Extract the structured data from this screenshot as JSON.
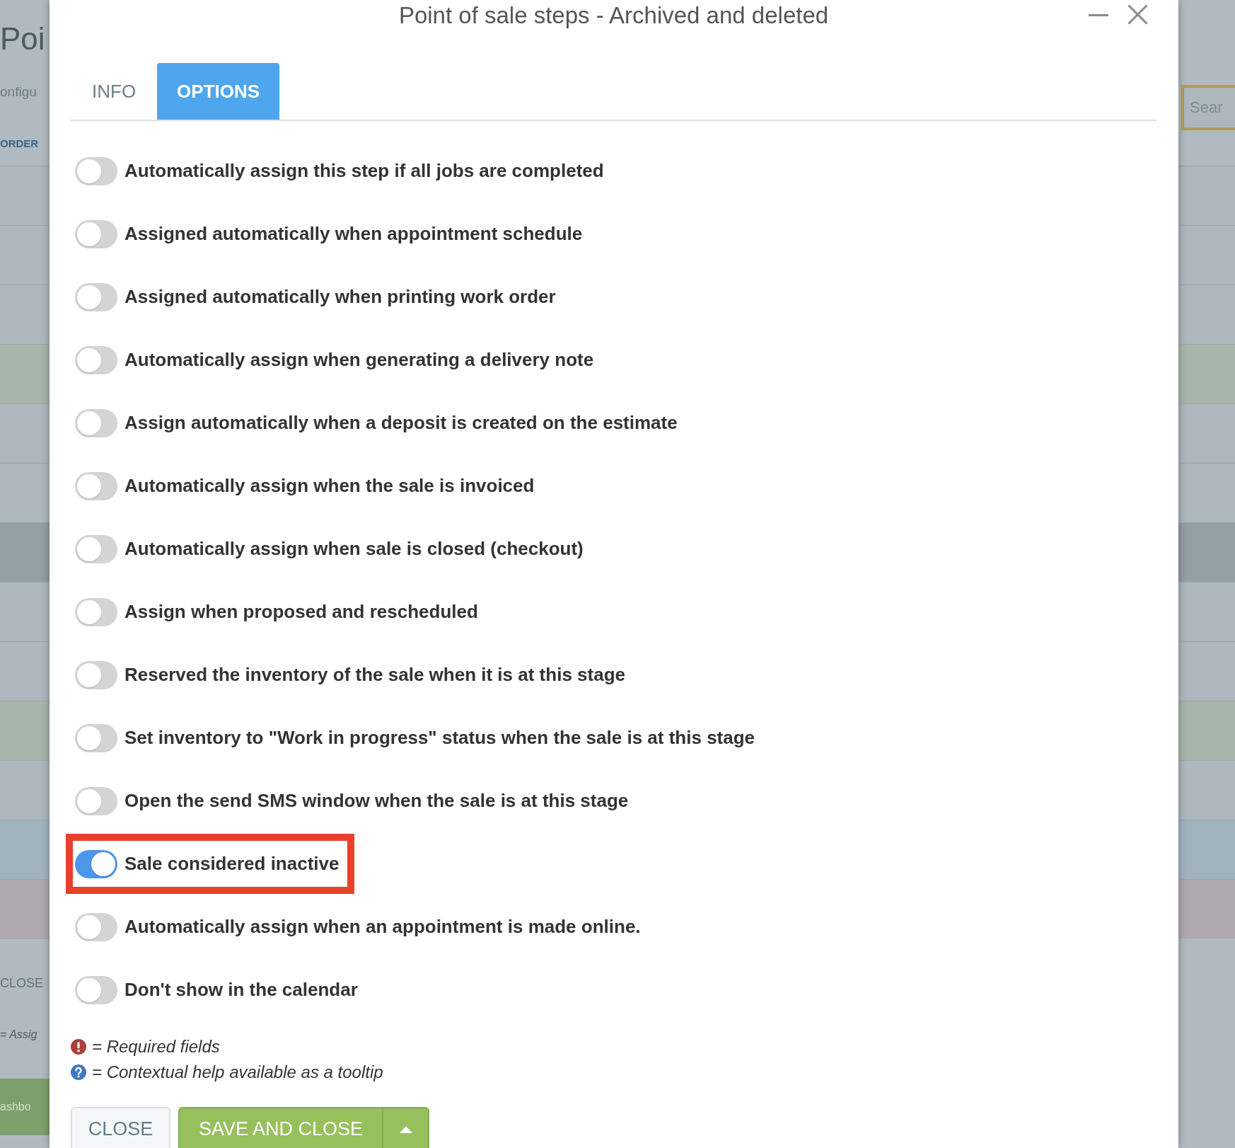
{
  "background_page": {
    "title": "Poi",
    "subtitle": "onfigu",
    "column_header": "ORDER",
    "search": {
      "placeholder": "Sear"
    },
    "rows": [
      {
        "color": "#adb7bd"
      },
      {
        "color": "#adb7bd"
      },
      {
        "color": "#adb7bd"
      },
      {
        "color": "#a7b5aa"
      },
      {
        "color": "#adb7bd"
      },
      {
        "color": "#adb7bd"
      },
      {
        "color": "#949ea5"
      },
      {
        "color": "#adb7bd"
      },
      {
        "color": "#adb7bd"
      },
      {
        "color": "#a7b5aa"
      },
      {
        "color": "#adb7bd"
      },
      {
        "color": "#a1b2bf"
      },
      {
        "color": "#afa8af"
      }
    ],
    "footer_label": "CLOSE",
    "legend_text": "= Assig",
    "nav_button": "ashbo"
  },
  "dialog": {
    "title": "Point of sale steps - Archived and deleted",
    "tabs": [
      {
        "label": "INFO",
        "selected": false
      },
      {
        "label": "OPTIONS",
        "selected": true
      }
    ],
    "options": [
      {
        "label": "Automatically assign this step if all jobs are completed",
        "on": false,
        "highlighted": false
      },
      {
        "label": "Assigned automatically when appointment schedule",
        "on": false,
        "highlighted": false
      },
      {
        "label": "Assigned automatically when printing work order",
        "on": false,
        "highlighted": false
      },
      {
        "label": "Automatically assign when generating a delivery note",
        "on": false,
        "highlighted": false
      },
      {
        "label": "Assign automatically when a deposit is created on the estimate",
        "on": false,
        "highlighted": false
      },
      {
        "label": "Automatically assign when the sale is invoiced",
        "on": false,
        "highlighted": false
      },
      {
        "label": "Automatically assign when sale is closed (checkout)",
        "on": false,
        "highlighted": false
      },
      {
        "label": "Assign when proposed and rescheduled",
        "on": false,
        "highlighted": false
      },
      {
        "label": "Reserved the inventory of the sale when it is at this stage",
        "on": false,
        "highlighted": false
      },
      {
        "label": "Set inventory to \"Work in progress\" status when the sale is at this stage",
        "on": false,
        "highlighted": false
      },
      {
        "label": "Open the send SMS window when the sale is at this stage",
        "on": false,
        "highlighted": false
      },
      {
        "label": "Sale considered inactive",
        "on": true,
        "highlighted": true
      },
      {
        "label": "Automatically assign when an appointment is made online.",
        "on": false,
        "highlighted": false
      },
      {
        "label": "Don't show in the calendar",
        "on": false,
        "highlighted": false
      }
    ],
    "legend": [
      {
        "kind": "required",
        "text": "= Required fields"
      },
      {
        "kind": "help",
        "text": "= Contextual help available as a tooltip"
      }
    ],
    "buttons": [
      {
        "kind": "secondary",
        "label": "CLOSE"
      },
      {
        "kind": "primary",
        "label": "SAVE AND CLOSE",
        "dropdown": true
      }
    ]
  }
}
